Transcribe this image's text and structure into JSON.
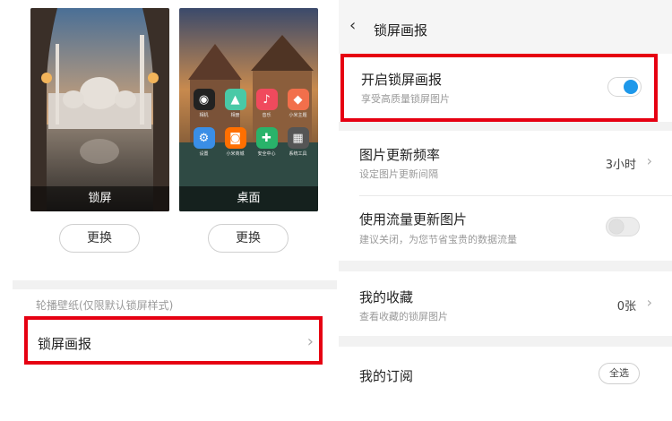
{
  "left": {
    "lock_caption": "锁屏",
    "home_caption": "桌面",
    "change_lock_label": "更换",
    "change_home_label": "更换",
    "section_hint": "轮播壁纸(仅限默认锁屏样式)",
    "lockscreen_row_label": "锁屏画报",
    "home_apps": [
      {
        "label": "相机",
        "icon": "camera-icon",
        "color": "#222222"
      },
      {
        "label": "相册",
        "icon": "gallery-icon",
        "color": "#49c9a6"
      },
      {
        "label": "音乐",
        "icon": "music-icon",
        "color": "#f04a5d"
      },
      {
        "label": "小米主题",
        "icon": "theme-icon",
        "color": "#f26f4b"
      },
      {
        "label": "设置",
        "icon": "settings-icon",
        "color": "#3a8ee6"
      },
      {
        "label": "小米商城",
        "icon": "store-icon",
        "color": "#ff6f00"
      },
      {
        "label": "安全中心",
        "icon": "shield-icon",
        "color": "#29b36a"
      },
      {
        "label": "系统工具",
        "icon": "tools-icon",
        "color": "#555555"
      }
    ]
  },
  "right": {
    "header": {
      "title": "锁屏画报"
    },
    "rows": {
      "enable": {
        "title": "开启锁屏画报",
        "subtitle": "享受高质量锁屏图片",
        "toggle": "on"
      },
      "frequency": {
        "title": "图片更新频率",
        "subtitle": "设定图片更新间隔",
        "value": "3小时"
      },
      "data": {
        "title": "使用流量更新图片",
        "subtitle": "建议关闭，为您节省宝贵的数据流量",
        "toggle": "off"
      },
      "favorites": {
        "title": "我的收藏",
        "subtitle": "查看收藏的锁屏图片",
        "value": "0张"
      },
      "subscriptions": {
        "title": "我的订阅",
        "button": "全选"
      }
    }
  },
  "colors": {
    "accent": "#1e98ea",
    "highlight": "#e60012"
  }
}
